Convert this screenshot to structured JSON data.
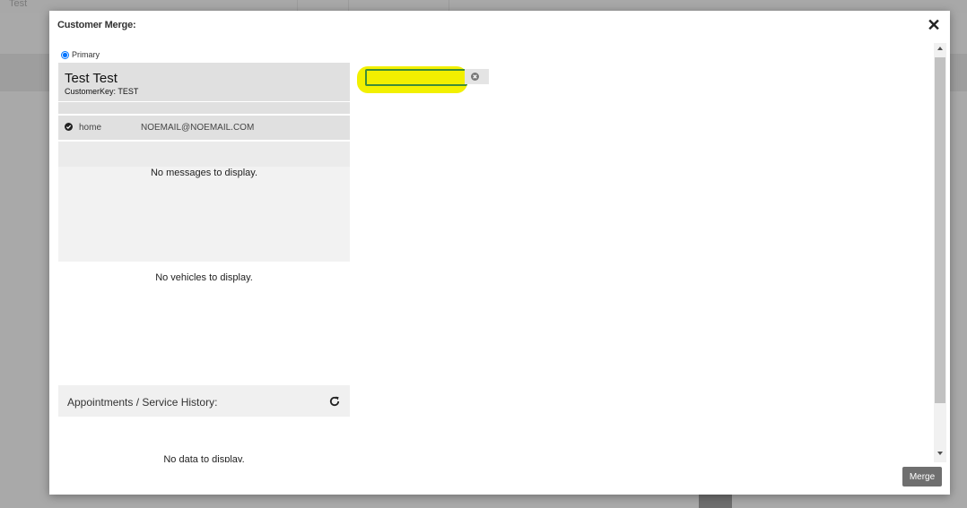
{
  "background": {
    "tab_label": "Test"
  },
  "modal": {
    "title": "Customer Merge:",
    "close_icon": "close-icon",
    "merge_label": "Merge"
  },
  "primary": {
    "radio_label": "Primary",
    "selected": true,
    "customer_name": "Test Test",
    "customer_key": "CustomerKey: TEST",
    "email": {
      "type": "home",
      "address": "NOEMAIL@NOEMAIL.COM",
      "icon": "check-circle-icon"
    },
    "messages_empty": "No messages to display.",
    "vehicles_empty": "No vehicles to display.",
    "appointments_header": "Appointments / Service History:",
    "refresh_icon": "refresh-icon",
    "history_empty": "No data to display."
  },
  "search": {
    "value": "",
    "highlight_color": "#f2f000",
    "clear_icon": "clear-icon"
  },
  "colors": {
    "overlay": "#a9a9a9",
    "panel_gray": "#e0e0e0",
    "merge_button": "#6f6f6f",
    "radio_blue": "#1a73e8"
  }
}
